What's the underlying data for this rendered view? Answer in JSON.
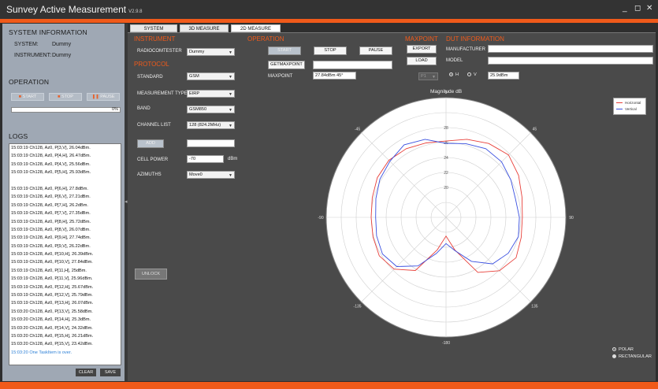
{
  "app": {
    "title": "Sunvey Active Measurement",
    "version": "V2.9.8"
  },
  "window_controls": {
    "minimize": "_",
    "restore": "◻",
    "close": "✕"
  },
  "left": {
    "system_info_title": "SYSTEM INFORMATION",
    "system_label": "SYSTEM:",
    "system_value": "Dummy",
    "instrument_label": "INSTRUMENT:",
    "instrument_value": "Dummy",
    "operation_title": "OPERATION",
    "start": "START",
    "stop": "STOP",
    "pause": "PAUSE",
    "progress": "0%",
    "progress_value": 0,
    "logs_title": "LOGS",
    "logs": [
      "15:03:19 Ch128, Az0, P[3,V], 26.04dBm.",
      "15:03:19 Ch128, Az0, P[4,H], 26.47dBm.",
      "15:03:19 Ch128, Az0, P[4,V], 25.56dBm.",
      "15:03:19 Ch128, Az0, P[5,H], 25.93dBm.",
      "",
      "15:03:19 Ch128, Az0, P[6,H], 27.8dBm.",
      "15:03:19 Ch128, Az0, P[6,V], 27.21dBm.",
      "15:03:19 Ch128, Az0, P[7,H], 26.2dBm.",
      "15:03:19 Ch128, Az0, P[7,V], 27.35dBm.",
      "15:03:19 Ch128, Az0, P[8,H], 25.72dBm.",
      "15:03:19 Ch128, Az0, P[8,V], 26.07dBm.",
      "15:03:19 Ch128, Az0, P[9,H], 27.74dBm.",
      "15:03:19 Ch128, Az0, P[9,V], 26.22dBm.",
      "15:03:19 Ch128, Az0, P[10,H], 26.39dBm.",
      "15:03:19 Ch128, Az0, P[10,V], 27.84dBm.",
      "15:03:19 Ch128, Az0, P[11,H], 25dBm.",
      "15:03:19 Ch128, Az0, P[11,V], 25.96dBm.",
      "15:03:19 Ch128, Az0, P[12,H], 25.67dBm.",
      "15:03:19 Ch128, Az0, P[12,V], 25.79dBm.",
      "15:03:19 Ch128, Az0, P[13,H], 26.07dBm.",
      "15:03:20 Ch128, Az0, P[13,V], 25.58dBm.",
      "15:03:20 Ch128, Az0, P[14,H], 25.3dBm.",
      "15:03:20 Ch128, Az0, P[14,V], 24.32dBm.",
      "15:03:20 Ch128, Az0, P[15,H], 26.21dBm.",
      "15:03:20 Ch128, Az0, P[15,V], 23.42dBm.",
      "15:03:20 One TaskItem is over."
    ],
    "clear": "CLEAR",
    "save": "SAVE"
  },
  "tabs": [
    "SYSTEM",
    "3D MEASURE",
    "2D MEASURE"
  ],
  "instrument": {
    "title": "INSTRUMENT",
    "radiocomtester_label": "RADIOCOMTESTER",
    "radiocomtester_value": "Dummy"
  },
  "protocol": {
    "title": "PROTOCOL",
    "standard_label": "STANDARD",
    "standard_value": "GSM",
    "mtype_label": "MEASUREMENT TYPE",
    "mtype_value": "EIRP",
    "band_label": "BAND",
    "band_value": "GSM850",
    "channel_label": "CHANNEL LIST",
    "channel_value": "128 (824.2MHz)",
    "add": "ADD",
    "add_input": "",
    "cell_power_label": "CELL POWER",
    "cell_power_value": "-70",
    "cell_power_unit": "dBm",
    "azimuths_label": "AZIMUTHS",
    "azimuths_value": "Move0",
    "unlock": "UNLOCK"
  },
  "operation": {
    "title": "OPERATION",
    "start": "START",
    "stop": "STOP",
    "pause": "PAUSE",
    "getmaxpoint": "GETMAXPOINT",
    "getmaxpoint_input": "",
    "maxpoint_label": "MAXPOINT",
    "maxpoint_value": "27.84dBm  45°"
  },
  "maxpoint": {
    "title": "MAXPOINT",
    "export": "EXPORT",
    "load": "LOAD",
    "point_select": "P1",
    "h_label": "H",
    "v_label": "V",
    "value": "25.9dBm"
  },
  "dut": {
    "title": "DUT INFORMATION",
    "manufacturer_label": "MANUFACTURER",
    "manufacturer_value": "",
    "model_label": "MODEL",
    "model_value": ""
  },
  "view_modes": {
    "polar": "POLAR",
    "rectangular": "RECTANGULAR",
    "selected": "polar"
  },
  "colors": {
    "accent": "#f05a1a",
    "horizontal": "#e8403a",
    "vertical": "#3a50e0"
  },
  "chart_data": {
    "type": "polar",
    "title": "Magnitude dB",
    "radial_ticks": [
      20,
      22,
      24,
      26,
      28
    ],
    "rlim": [
      16,
      32
    ],
    "angle_labels": [
      "0",
      "45",
      "90",
      "135",
      "-180",
      "-135",
      "-90",
      "-45"
    ],
    "series": [
      {
        "name": "Horizontal",
        "angles": [
          0,
          15,
          30,
          45,
          60,
          75,
          90,
          105,
          120,
          135,
          150,
          165,
          180,
          195,
          210,
          225,
          240,
          255,
          270,
          285,
          300,
          315,
          330,
          345
        ],
        "values": [
          26.2,
          26.8,
          27.4,
          27.8,
          27.2,
          26.5,
          26.2,
          26.4,
          26.8,
          26.1,
          24.5,
          20.5,
          18.5,
          20.5,
          24.2,
          25.8,
          26.3,
          26.1,
          26.0,
          26.2,
          26.6,
          26.8,
          26.6,
          26.3
        ]
      },
      {
        "name": "Vertical",
        "angles": [
          0,
          15,
          30,
          45,
          60,
          75,
          90,
          105,
          120,
          135,
          150,
          165,
          180,
          195,
          210,
          225,
          240,
          255,
          270,
          285,
          300,
          315,
          330,
          345
        ],
        "values": [
          25.9,
          26.2,
          26.6,
          26.5,
          26.0,
          25.6,
          25.8,
          26.0,
          25.6,
          24.8,
          22.8,
          20.6,
          19.5,
          21.0,
          23.5,
          25.3,
          25.8,
          25.6,
          25.4,
          25.7,
          26.2,
          26.6,
          27.2,
          26.8
        ]
      }
    ]
  }
}
